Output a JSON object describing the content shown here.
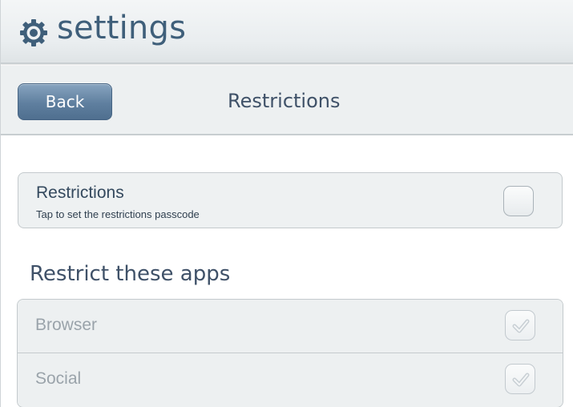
{
  "appbar": {
    "title": "settings",
    "icon": "gear-icon"
  },
  "navbar": {
    "back_label": "Back",
    "title": "Restrictions"
  },
  "restrictions": {
    "label": "Restrictions",
    "sublabel": "Tap to set the restrictions passcode",
    "checked": false
  },
  "apps_section": {
    "heading": "Restrict these apps",
    "items": [
      {
        "label": "Browser",
        "checked": true,
        "enabled": false
      },
      {
        "label": "Social",
        "checked": true,
        "enabled": false
      }
    ]
  },
  "colors": {
    "accent": "#5f7f9f",
    "title_text": "#3f5f7a",
    "disabled_text": "#9aa3aa"
  }
}
